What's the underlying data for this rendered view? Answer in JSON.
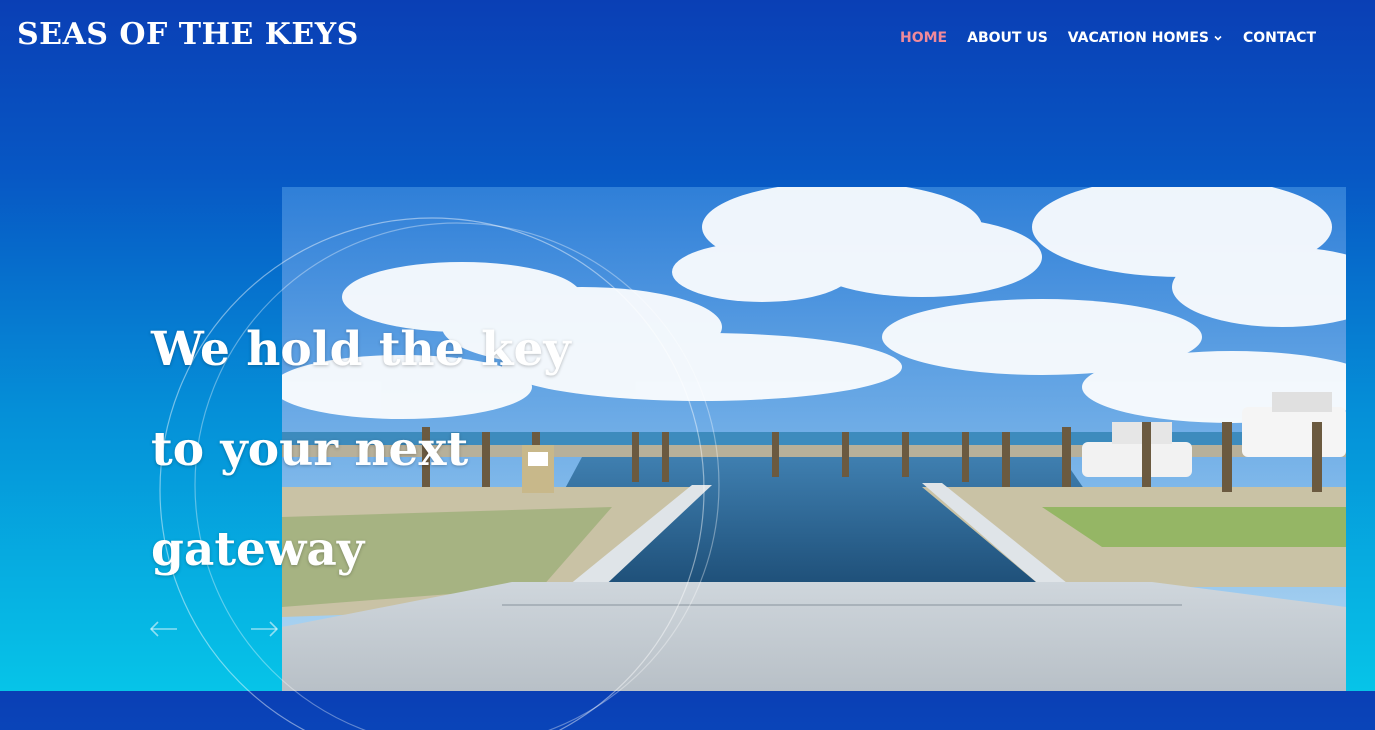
{
  "brand": {
    "logo_text": "SEAS OF THE KEYS"
  },
  "nav": {
    "items": [
      {
        "label": "HOME",
        "active": true
      },
      {
        "label": "ABOUT US",
        "active": false
      },
      {
        "label": "VACATION HOMES",
        "active": false,
        "has_dropdown": true
      },
      {
        "label": "CONTACT",
        "active": false
      }
    ]
  },
  "hero": {
    "headline_lines": [
      "We hold the key",
      "to your next",
      "gateway"
    ],
    "image_subject": "marina boat ramp with docks under a blue sky",
    "controls": {
      "prev_icon": "arrow-left-icon",
      "next_icon": "arrow-right-icon"
    }
  },
  "colors": {
    "bg_top": "#0a3fb5",
    "bg_bottom": "#06c4e8",
    "nav_active": "#f08a9a",
    "text": "#ffffff"
  }
}
